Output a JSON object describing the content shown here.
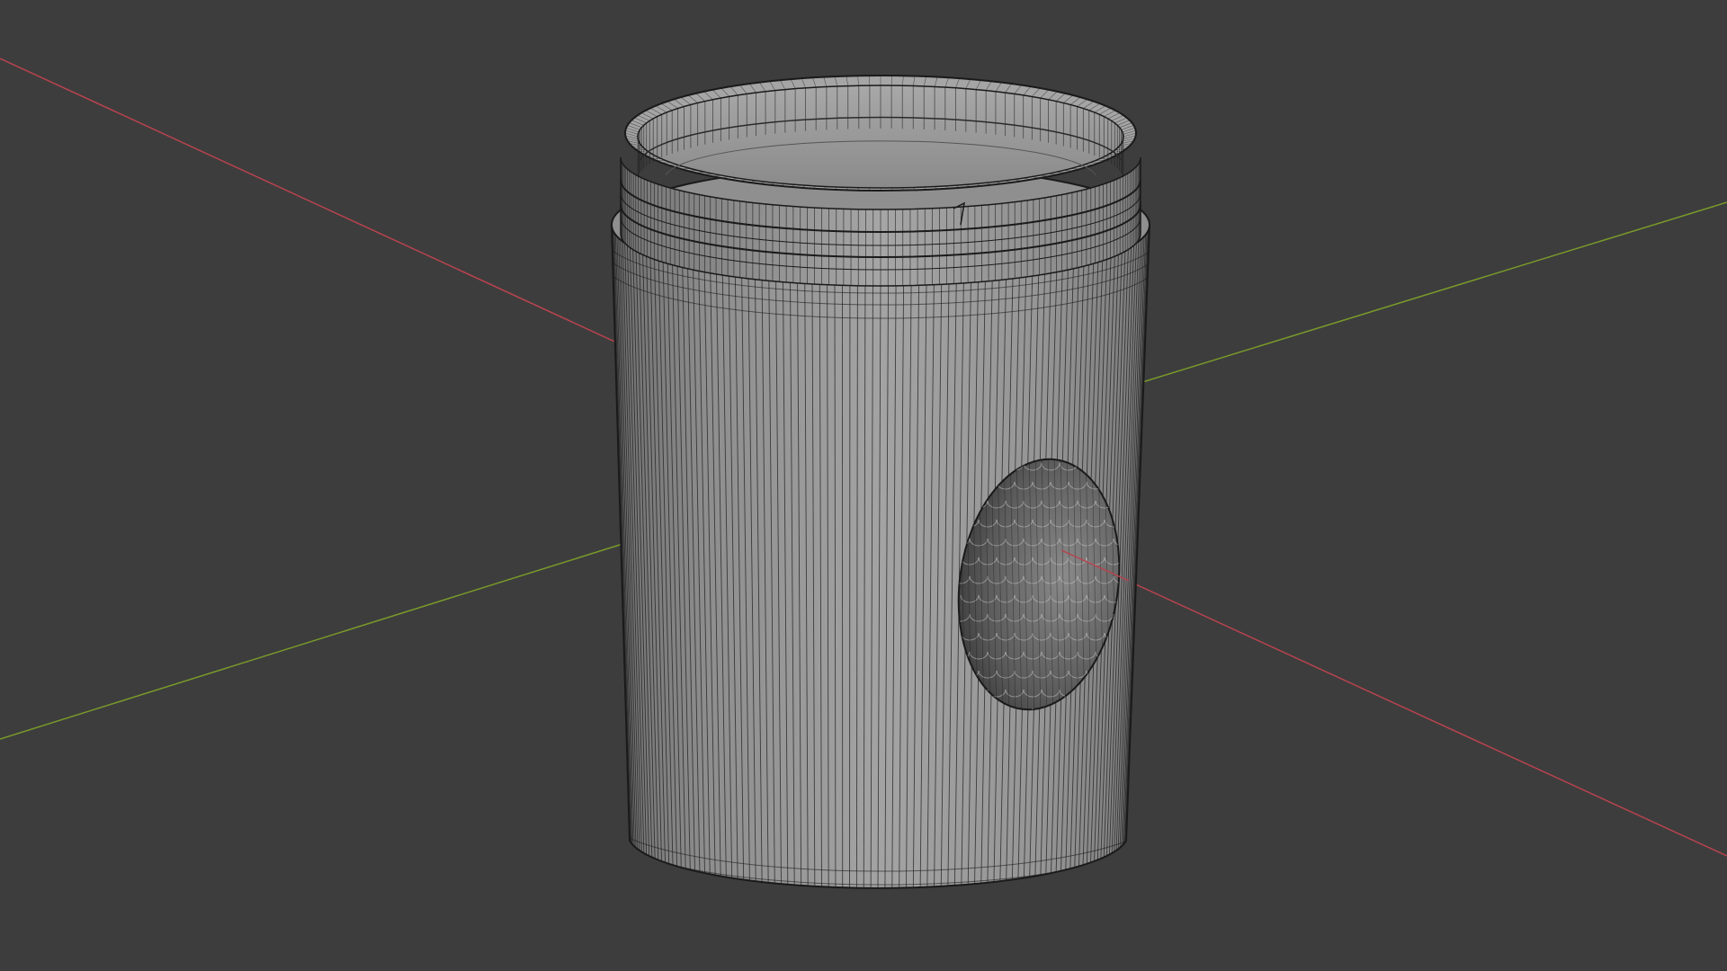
{
  "viewport": {
    "mode": "wireframe-overlay",
    "background_color": "#3d3d3d",
    "mesh_color": "#9a9a9a",
    "wire_color": "#1c1c1c",
    "axes": {
      "x_axis_color": "#b8434e",
      "y_axis_color": "#7a9a2a"
    },
    "object": {
      "type": "threaded-jar",
      "features": [
        "threaded-neck",
        "side-cutout"
      ]
    }
  }
}
